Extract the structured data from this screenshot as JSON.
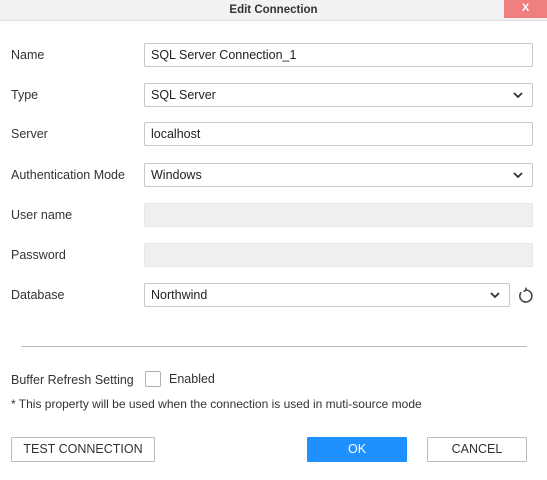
{
  "window": {
    "title": "Edit Connection",
    "close_label": "X"
  },
  "form": {
    "name": {
      "label": "Name",
      "value": "SQL Server Connection_1"
    },
    "type": {
      "label": "Type",
      "value": "SQL Server"
    },
    "server": {
      "label": "Server",
      "value": "localhost"
    },
    "auth_mode": {
      "label": "Authentication Mode",
      "value": "Windows"
    },
    "username": {
      "label": "User name",
      "value": ""
    },
    "password": {
      "label": "Password",
      "value": ""
    },
    "database": {
      "label": "Database",
      "value": "Northwind"
    }
  },
  "buffer": {
    "label": "Buffer Refresh Setting",
    "checkbox_label": "Enabled",
    "checked": false,
    "note": "* This property will be used when the connection is used in muti-source mode"
  },
  "buttons": {
    "test": "TEST CONNECTION",
    "ok": "OK",
    "cancel": "CANCEL"
  },
  "colors": {
    "primary": "#1e90ff",
    "close": "#f08080",
    "titlebar": "#f2f2f2"
  },
  "icons": {
    "dropdown": "chevron-down-icon",
    "refresh": "refresh-icon"
  }
}
